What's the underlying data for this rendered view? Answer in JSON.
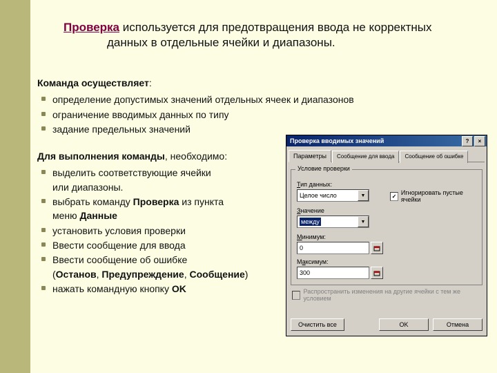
{
  "title": {
    "link": "Проверка",
    "rest": "  используется для предотвращения ввода не корректных"
  },
  "subtitle": "данных в отдельные ячейки и диапазоны.",
  "section1": {
    "head": "Команда осуществляет",
    "colon": ":",
    "items": [
      " определение допустимых значений отдельных ячеек и  диапазонов",
      "ограничение вводимых данных по типу",
      "задание предельных значений"
    ]
  },
  "section2": {
    "head": "Для выполнения команды",
    "tail": ", необходимо:",
    "items": [
      {
        "t": "выделить соответствующие ячейки\nили диапазоны."
      },
      {
        "pre": "выбрать команду ",
        "b1": "Проверка",
        "mid": " из пункта\nменю ",
        "b2": "Данные"
      },
      {
        "t": "установить условия проверки"
      },
      {
        "t": "Ввести сообщение для ввода"
      },
      {
        "t": "Ввести сообщение об ошибке"
      },
      {
        "t": "(",
        "b1": "Останов",
        "mid": ", ",
        "b2": "Предупреждение",
        "mid2": ", ",
        "b3": "Сообщение",
        "after": ")",
        "noBullet": true
      },
      {
        "pre": "нажать командную кнопку ",
        "b1": "OK"
      }
    ]
  },
  "dialog": {
    "title": "Проверка вводимых значений",
    "tabs": [
      "Параметры",
      "Сообщение для ввода",
      "Сообщение об ошибке"
    ],
    "group": "Условие проверки",
    "typeLabel": "Тип данных:",
    "typeValue": "Целое число",
    "ignoreLabel": "Игнорировать пустые ячейки",
    "valueLabel": "Значение",
    "valueSel": "между",
    "minLabel": "Минимум:",
    "minVal": "0",
    "maxLabel": "Максимум:",
    "maxVal": "300",
    "applyLabel": "Распространить изменения на другие ячейки с тем же условием",
    "clearBtn": "Очистить все",
    "okBtn": "OK",
    "cancelBtn": "Отмена"
  }
}
